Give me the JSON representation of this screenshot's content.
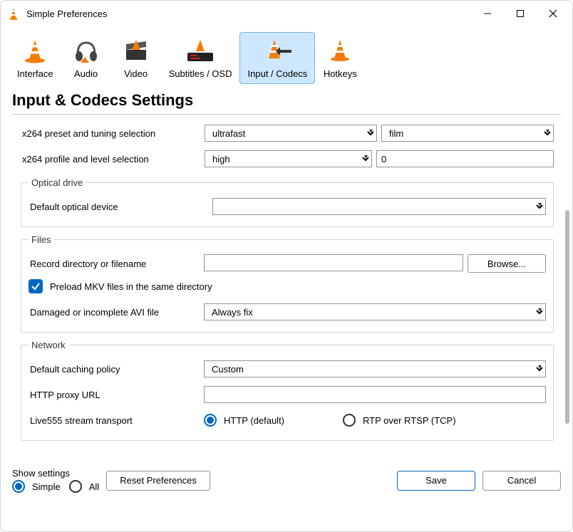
{
  "window": {
    "title": "Simple Preferences"
  },
  "tabs": [
    {
      "label": "Interface"
    },
    {
      "label": "Audio"
    },
    {
      "label": "Video"
    },
    {
      "label": "Subtitles / OSD"
    },
    {
      "label": "Input / Codecs"
    },
    {
      "label": "Hotkeys"
    }
  ],
  "heading": "Input & Codecs Settings",
  "x264": {
    "preset_label": "x264 preset and tuning selection",
    "preset_value": "ultrafast",
    "tuning_value": "film",
    "profile_label": "x264 profile and level selection",
    "profile_value": "high",
    "level_value": "0"
  },
  "optical": {
    "legend": "Optical drive",
    "device_label": "Default optical device",
    "device_value": ""
  },
  "files": {
    "legend": "Files",
    "record_label": "Record directory or filename",
    "record_value": "",
    "browse": "Browse...",
    "preload_label": "Preload MKV files in the same directory",
    "avi_label": "Damaged or incomplete AVI file",
    "avi_value": "Always fix"
  },
  "network": {
    "legend": "Network",
    "caching_label": "Default caching policy",
    "caching_value": "Custom",
    "proxy_label": "HTTP proxy URL",
    "proxy_value": "",
    "live555_label": "Live555 stream transport",
    "opt_http": "HTTP (default)",
    "opt_rtp": "RTP over RTSP (TCP)"
  },
  "footer": {
    "show_settings": "Show settings",
    "simple": "Simple",
    "all": "All",
    "reset": "Reset Preferences",
    "save": "Save",
    "cancel": "Cancel"
  }
}
